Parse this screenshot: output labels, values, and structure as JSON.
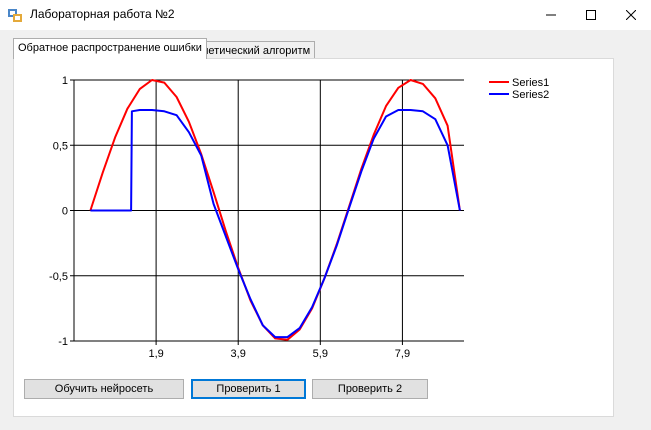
{
  "window": {
    "title": "Лабораторная работа №2",
    "minimize_icon": "minimize-icon",
    "maximize_icon": "maximize-icon",
    "close_icon": "close-icon"
  },
  "tabs": [
    {
      "label": "Обратное распространение ошибки",
      "active": true
    },
    {
      "label": "Генетический алгоритм",
      "active": false
    }
  ],
  "buttons": {
    "train": "Обучить нейросеть",
    "check1": "Проверить 1",
    "check2": "Проверить 2"
  },
  "chart_data": {
    "type": "line",
    "title": "",
    "xlabel": "",
    "ylabel": "",
    "xlim": [
      -0.1,
      9.4
    ],
    "ylim": [
      -1,
      1
    ],
    "x_ticks": [
      1.9,
      3.9,
      5.9,
      7.9
    ],
    "x_tick_labels": [
      "1,9",
      "3,9",
      "5,9",
      "7,9"
    ],
    "y_ticks": [
      -1,
      -0.5,
      0,
      0.5,
      1
    ],
    "y_tick_labels": [
      "-1",
      "-0,5",
      "0",
      "0,5",
      "1"
    ],
    "grid": true,
    "legend_position": "top-right",
    "series": [
      {
        "name": "Series1",
        "color": "#ff0000",
        "x": [
          0.3,
          0.6,
          0.9,
          1.2,
          1.5,
          1.8,
          2.1,
          2.4,
          2.7,
          3.0,
          3.3,
          3.6,
          3.9,
          4.2,
          4.5,
          4.8,
          5.1,
          5.4,
          5.7,
          6.0,
          6.3,
          6.6,
          6.9,
          7.2,
          7.5,
          7.8,
          8.1,
          8.4,
          8.7,
          9.0,
          9.3
        ],
        "y": [
          0.0,
          0.29,
          0.56,
          0.78,
          0.93,
          1.0,
          0.98,
          0.87,
          0.68,
          0.43,
          0.14,
          -0.16,
          -0.44,
          -0.69,
          -0.88,
          -0.98,
          -0.99,
          -0.91,
          -0.75,
          -0.52,
          -0.26,
          0.03,
          0.32,
          0.58,
          0.8,
          0.94,
          1.0,
          0.97,
          0.86,
          0.65,
          0.0
        ]
      },
      {
        "name": "Series2",
        "color": "#0000ff",
        "x": [
          0.3,
          0.6,
          0.9,
          1.2,
          1.29,
          1.31,
          1.5,
          1.8,
          2.1,
          2.4,
          2.7,
          3.0,
          3.3,
          3.6,
          3.9,
          4.2,
          4.5,
          4.8,
          5.1,
          5.4,
          5.7,
          6.0,
          6.3,
          6.6,
          6.9,
          7.2,
          7.5,
          7.8,
          8.1,
          8.4,
          8.7,
          9.0,
          9.3
        ],
        "y": [
          0.0,
          0.0,
          0.0,
          0.0,
          0.0,
          0.76,
          0.77,
          0.77,
          0.76,
          0.73,
          0.6,
          0.42,
          0.05,
          -0.2,
          -0.45,
          -0.68,
          -0.88,
          -0.97,
          -0.97,
          -0.9,
          -0.74,
          -0.52,
          -0.27,
          0.02,
          0.3,
          0.55,
          0.72,
          0.77,
          0.77,
          0.76,
          0.7,
          0.5,
          0.0
        ]
      }
    ]
  }
}
